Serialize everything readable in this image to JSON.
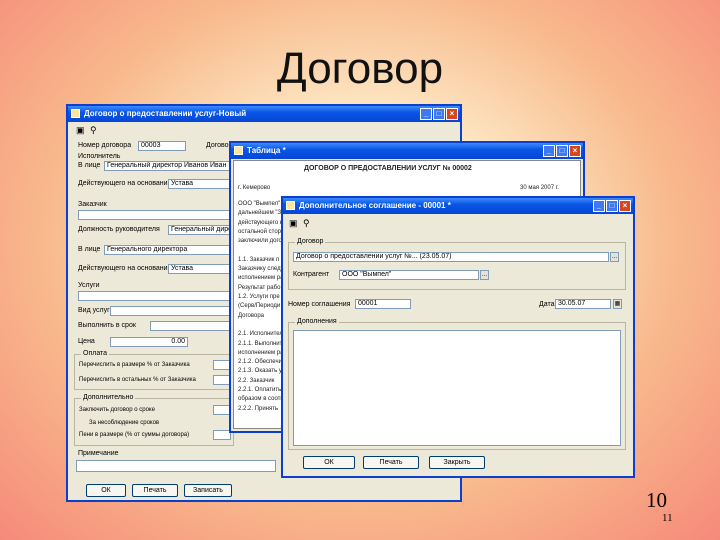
{
  "slide": {
    "title": "Договор",
    "number_large": "10",
    "number_small": "11"
  },
  "window1": {
    "title": "Договор о предоставлении услуг-Новый",
    "rows": [
      {
        "label": "Номер договора",
        "value": "00003"
      },
      {
        "label": "Договор",
        "value": ""
      },
      {
        "label": "Исполнитель",
        "value": ""
      },
      {
        "label": "В лице",
        "value": "Генеральный директор Иванов Иван Ив"
      },
      {
        "label": "Действующего на основании",
        "value": "Устава"
      },
      {
        "label": "Заказчик",
        "value": ""
      },
      {
        "label": "Должность руководителя",
        "value": "Генеральный дире"
      },
      {
        "label": "В лице",
        "value": "Генерального директора"
      },
      {
        "label": "Действующего на основании",
        "value": "Устава"
      },
      {
        "label": "Услуги",
        "value": ""
      },
      {
        "label": "Вид услуг",
        "value": ""
      },
      {
        "label": "Выполнить в срок",
        "value": ""
      },
      {
        "label": "Цена",
        "value": "0.00"
      }
    ],
    "group_payment": "Оплата",
    "payment_rows": [
      "Перечислить в размере % от Заказчика",
      "Перечислить в остальных % от Заказчика"
    ],
    "group_other": "Дополнительно",
    "other_rows": [
      "Заключить договор о сроке",
      "За несоблюдение сроков",
      "Пени в размере (% от суммы договора)"
    ],
    "notes_label": "Примечание",
    "buttons": [
      "ОК",
      "Печать",
      "Записать"
    ]
  },
  "window2": {
    "title": "Таблица *",
    "heading": "ДОГОВОР О ПРЕДОСТАВЛЕНИИ УСЛУГ № 00002",
    "city": "г. Кемерово",
    "date": "30 мая 2007 г.",
    "lines": [
      "ООО \"Вымпел\"",
      "дальнейшем \"За",
      "действующего н",
      "остальной стор",
      "заключили дого",
      "",
      "1.1. Заказчик п",
      "Заказчику следу",
      "исполнением ра",
      "Результат рабо",
      "1.2. Услуги пре",
      "(Серв/Периоди",
      "Договора",
      "",
      "2.1. Исполнител",
      "2.1.1. Выполнит",
      "исполнением ра",
      "2.1.2. Обеспечит",
      "2.1.3. Оказать ус",
      "2.2. Заказчик",
      "2.2.1. Оплатить",
      "образом в соотв",
      "2.2.2. Принять"
    ]
  },
  "window3": {
    "title": "Дополнительное соглашение - 00001 *",
    "group_contract": "Договор",
    "contract_value": "Договор о предоставлении услуг №... (23.05.07)",
    "counterparty_label": "Контрагент",
    "counterparty_value": "ООО \"Вымпел\"",
    "agreement_number_label": "Номер соглашения",
    "agreement_number_value": "00001",
    "date_label": "Дата",
    "date_value": "30.05.07",
    "group_additions": "Дополнения",
    "additions_text": "",
    "buttons": [
      "ОК",
      "Печать",
      "Закрыть"
    ]
  }
}
